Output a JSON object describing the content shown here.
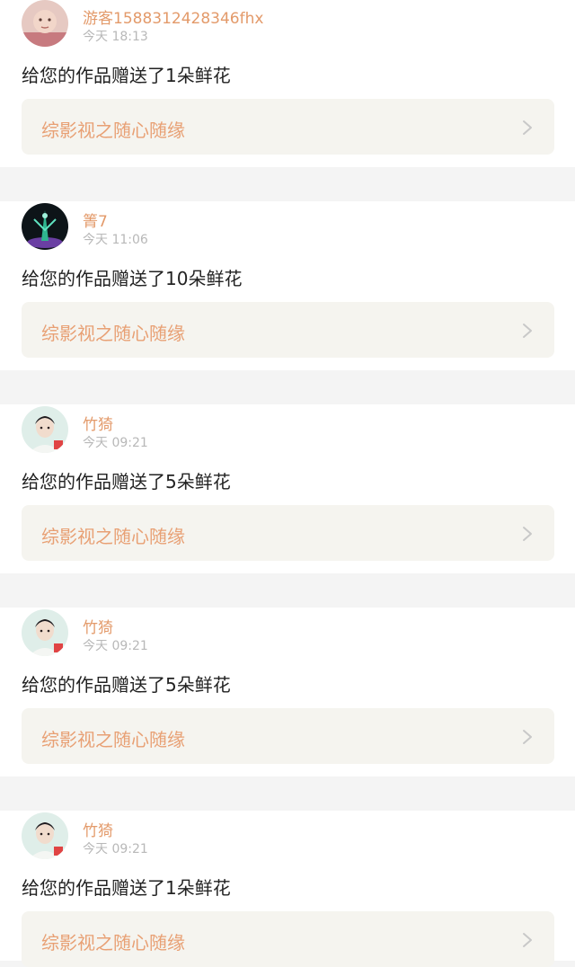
{
  "colors": {
    "username": "#e39a6a",
    "timestamp": "#b8b8b8",
    "message": "#222222",
    "link_text": "#e8a074",
    "link_bg": "#f5f4ef",
    "separator": "#f4f4f4"
  },
  "notifications": [
    {
      "username": "游客1588312428346fhx",
      "time": "今天 18:13",
      "message": "给您的作品赠送了1朵鲜花",
      "work_title": "综影视之随心随缘",
      "avatar_icon": "baby-photo-avatar",
      "chevron_icon": "chevron-right-icon"
    },
    {
      "username": "箐7",
      "time": "今天 11:06",
      "message": "给您的作品赠送了10朵鲜花",
      "work_title": "综影视之随心随缘",
      "avatar_icon": "dark-fantasy-avatar",
      "chevron_icon": "chevron-right-icon"
    },
    {
      "username": "竹猗",
      "time": "今天 09:21",
      "message": "给您的作品赠送了5朵鲜花",
      "work_title": "综影视之随心随缘",
      "avatar_icon": "portrait-avatar",
      "chevron_icon": "chevron-right-icon"
    },
    {
      "username": "竹猗",
      "time": "今天 09:21",
      "message": "给您的作品赠送了5朵鲜花",
      "work_title": "综影视之随心随缘",
      "avatar_icon": "portrait-avatar",
      "chevron_icon": "chevron-right-icon"
    },
    {
      "username": "竹猗",
      "time": "今天 09:21",
      "message": "给您的作品赠送了1朵鲜花",
      "work_title": "综影视之随心随缘",
      "avatar_icon": "portrait-avatar",
      "chevron_icon": "chevron-right-icon"
    }
  ]
}
